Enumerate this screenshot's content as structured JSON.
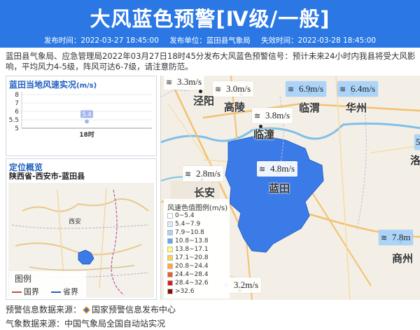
{
  "header": {
    "title": "大风蓝色预警[Ⅳ级/一般]",
    "publish_time": "发布时间：2022-03-27 18:45:00",
    "publisher": "发布单位：蓝田县气象局",
    "expire_time": "失效时间：2022-03-28 18:45:00",
    "background_color": "#2b78e4"
  },
  "description": "蓝田县气象局、应急管理局2022年03月27日18时45分发布大风蓝色预警信号：预计未来24小时内我县将受大风影响，平均风力4-5级，阵风可达6-7级，请注意防范。",
  "wind_panel": {
    "title": "蓝田当地风速实况",
    "unit": "(m/s)"
  },
  "chart_data": {
    "type": "scatter",
    "title": "蓝田当地风速实况(m/s)",
    "categories": [
      "18时"
    ],
    "values": [
      5.4
    ],
    "value_labels": [
      "5.4"
    ],
    "y_ticks": [
      "8",
      "7",
      "6",
      "5.5",
      "5"
    ],
    "point_color": "#a3b7ec"
  },
  "location": {
    "title": "定位概览",
    "path": "陕西省-西安市-蓝田县",
    "map_label": "西安",
    "legend_title": "图例",
    "legend_items": [
      {
        "label": "国界",
        "color": "#c0504d"
      },
      {
        "label": "省界",
        "color": "#2b5fbd"
      }
    ]
  },
  "main_map": {
    "highlight_color": "#3b7be8",
    "wind_labels": [
      {
        "text": "3.3m/s",
        "style": "white"
      },
      {
        "text": "3.0m/s",
        "style": "white"
      },
      {
        "text": "6.9m/s",
        "style": "blue"
      },
      {
        "text": "6.4m/s",
        "style": "blue"
      },
      {
        "text": "3.8m/s",
        "style": "white"
      },
      {
        "text": "4.8m/s",
        "style": "white"
      },
      {
        "text": "2.8m/s",
        "style": "white"
      },
      {
        "text": "7.8m",
        "style": "blue"
      },
      {
        "text": "3.2m/s",
        "style": "white"
      }
    ],
    "cities": [
      "泾阳",
      "高陵",
      "临渭",
      "华州",
      "临潼",
      "蓝田",
      "长安",
      "商州",
      "洛"
    ],
    "partial_badge": "5",
    "scale_legend": {
      "title": "风速色值图例(m/s)",
      "items": [
        {
          "label": "0~5.4",
          "color": "#ffffff"
        },
        {
          "label": "5.4~7.9",
          "color": "#dbe9fb"
        },
        {
          "label": "7.9~10.8",
          "color": "#a8d2fa"
        },
        {
          "label": "10.8~13.8",
          "color": "#5fa8f0"
        },
        {
          "label": "13.8~17.1",
          "color": "#ffff7a"
        },
        {
          "label": "17.1~20.8",
          "color": "#ffd24d"
        },
        {
          "label": "20.8~24.4",
          "color": "#ffa53c"
        },
        {
          "label": "24.4~28.4",
          "color": "#f05a23"
        },
        {
          "label": "28.4~32.6",
          "color": "#d42020"
        },
        {
          "label": ">32.6",
          "color": "#8c0a0a"
        }
      ]
    }
  },
  "footer": {
    "warning_source_label": "预警信息数据来源：",
    "warning_source": "国家预警信息发布中心",
    "weather_source": "气象数据来源：中国气象局全国自动站实况"
  }
}
